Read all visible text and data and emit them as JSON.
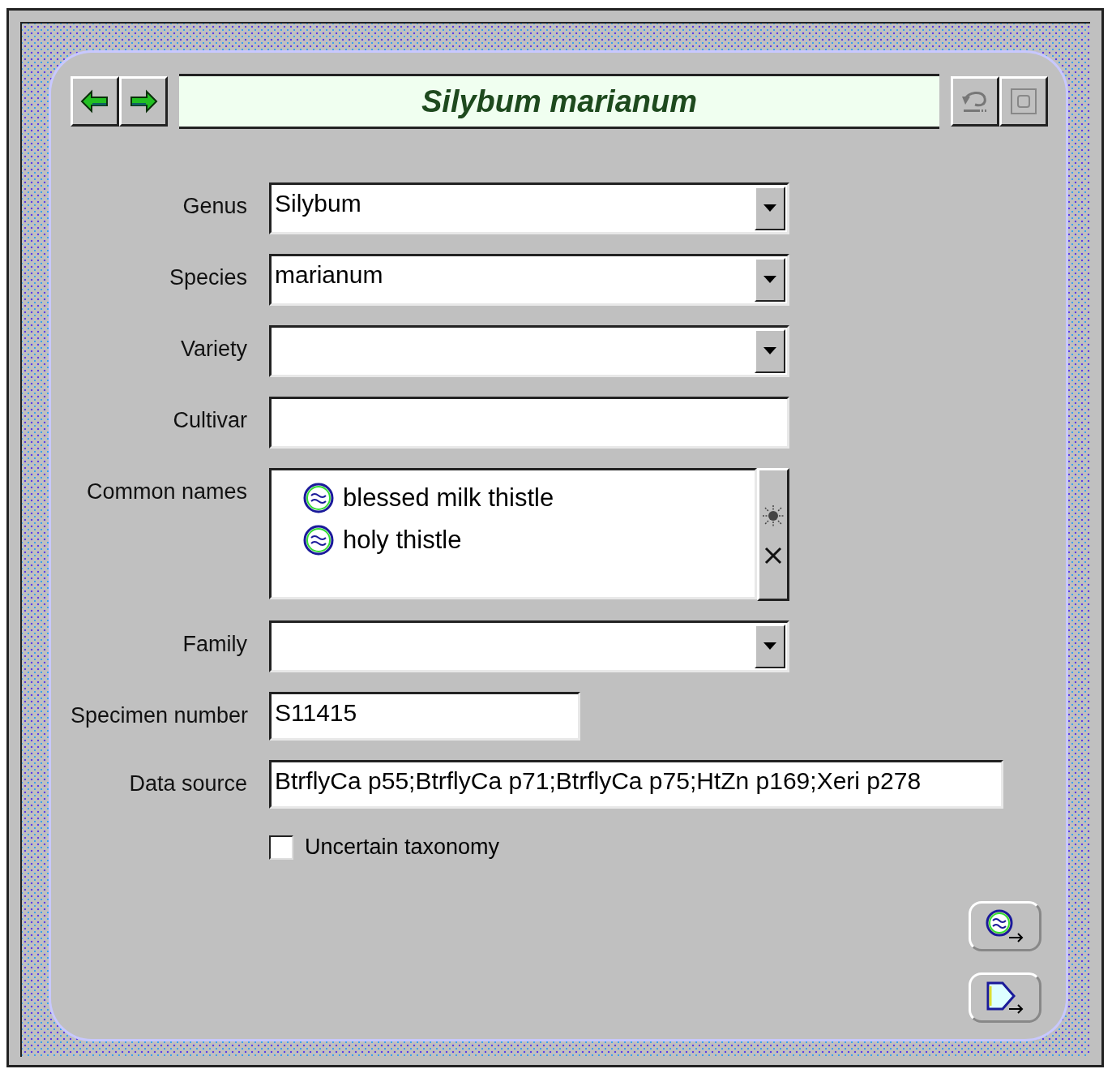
{
  "title": "Silybum marianum",
  "fields": [
    {
      "label": "Genus",
      "kind": "combo",
      "value": "Silybum"
    },
    {
      "label": "Species",
      "kind": "combo",
      "value": "marianum"
    },
    {
      "label": "Variety",
      "kind": "combo"
    },
    {
      "label": "Cultivar",
      "kind": "text"
    },
    {
      "label": "Common names",
      "kind": "list",
      "items": [
        "blessed milk thistle",
        "holy thistle"
      ]
    },
    {
      "label": "Family",
      "kind": "combo"
    },
    {
      "label": "Specimen number",
      "kind": "short",
      "value": "S11415"
    },
    {
      "label": "Data source",
      "kind": "long",
      "value": "BtrflyCa p55;BtrflyCa p71;BtrflyCa p75;HtZn p169;Xeri p278"
    }
  ],
  "checkbox": {
    "label": "Uncertain taxonomy",
    "checked": false
  }
}
